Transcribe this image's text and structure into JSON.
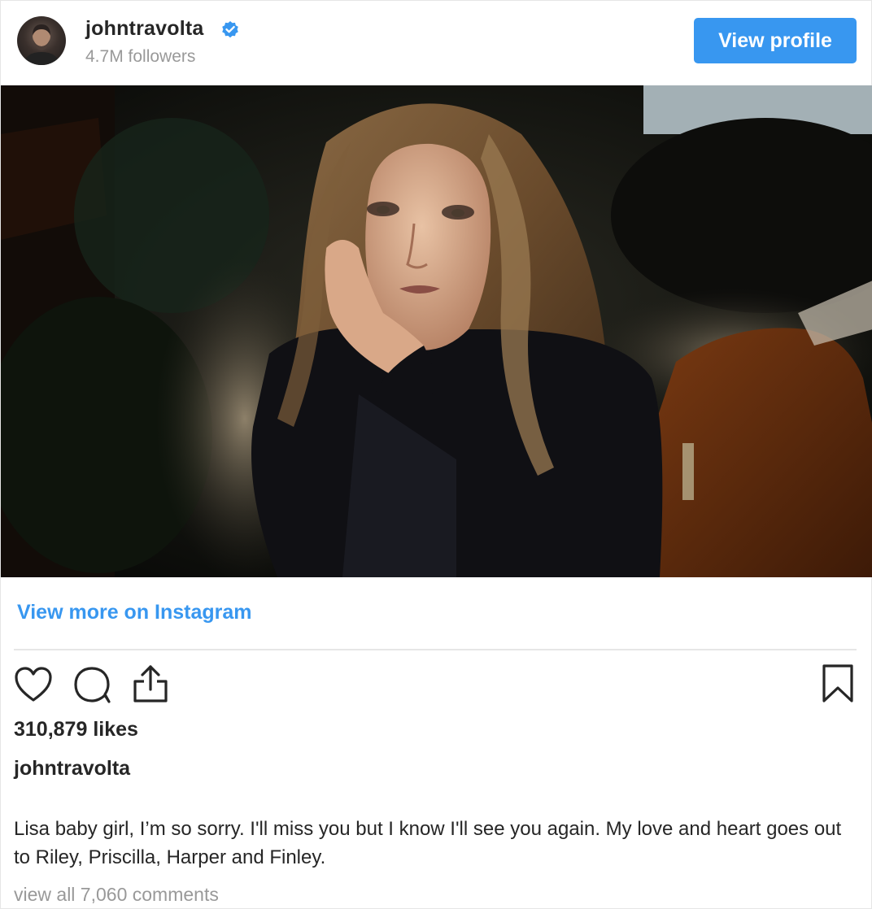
{
  "header": {
    "username": "johntravolta",
    "followers": "4.7M followers",
    "view_profile_label": "View profile"
  },
  "post": {
    "view_more_label": "View more on Instagram",
    "likes": "310,879 likes",
    "caption_user": "johntravolta",
    "caption_text": "Lisa baby girl, I’m so sorry. I'll miss you but I know I'll see you again. My love and heart goes out to Riley, Priscilla, Harper and Finley.",
    "comments_link": "view all 7,060 comments"
  },
  "icons": {
    "verified": "verified-badge-icon",
    "like": "heart-icon",
    "comment": "comment-icon",
    "share": "share-icon",
    "save": "bookmark-icon"
  },
  "colors": {
    "accent": "#3897f0",
    "text": "#262626",
    "muted": "#999999",
    "divider": "#e6e6e6"
  }
}
